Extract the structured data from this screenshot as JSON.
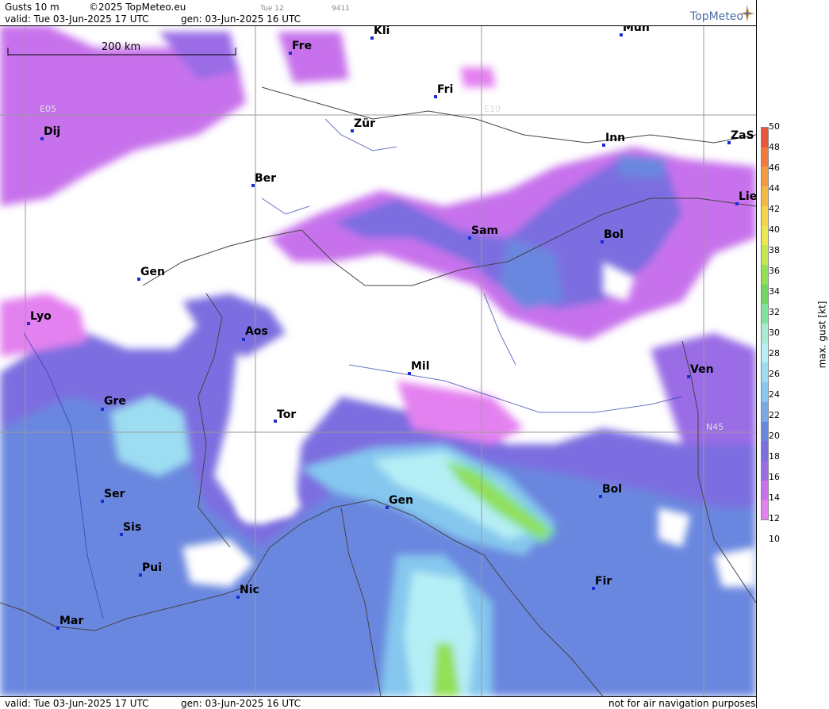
{
  "header": {
    "title": "Gusts 10 m",
    "copyright": "©2025 TopMeteo.eu",
    "valid": "valid:  Tue  03-Jun-2025  17 UTC",
    "gen": "gen:  03-Jun-2025  16 UTC",
    "small1": "Tue 12",
    "small2": "9411",
    "brand": "TopMeteo"
  },
  "footer": {
    "valid": "valid:  Tue  03-Jun-2025  17 UTC",
    "gen": "gen:  03-Jun-2025  16 UTC",
    "note": "not for air navigation purposes"
  },
  "scale": {
    "label": "200 km"
  },
  "grid": {
    "e05": "E05",
    "e10": "E10",
    "n45": "N45"
  },
  "legend": {
    "unit": "max. gust [kt]",
    "ticks": [
      "50",
      "48",
      "46",
      "44",
      "42",
      "40",
      "38",
      "36",
      "34",
      "32",
      "30",
      "28",
      "26",
      "24",
      "22",
      "20",
      "18",
      "16",
      "14",
      "12",
      "10"
    ],
    "colors": [
      "#e8573a",
      "#f07a3c",
      "#f49a40",
      "#f7b843",
      "#f5d44a",
      "#eaea50",
      "#c4e84e",
      "#93df55",
      "#6fd860",
      "#7fe39e",
      "#a8ecd6",
      "#b5eef5",
      "#9dddf2",
      "#85c7ee",
      "#78a9e6",
      "#6a87df",
      "#7b6ee0",
      "#9a6ce6",
      "#c772ec",
      "#e481f0"
    ]
  },
  "cities": [
    {
      "name": "Kli"
    },
    {
      "name": "Mün"
    },
    {
      "name": "Fre"
    },
    {
      "name": "Fri"
    },
    {
      "name": "Dij"
    },
    {
      "name": "Zür"
    },
    {
      "name": "Inn"
    },
    {
      "name": "ZaS"
    },
    {
      "name": "Ber"
    },
    {
      "name": "Lie"
    },
    {
      "name": "Sam"
    },
    {
      "name": "Bol"
    },
    {
      "name": "Gen"
    },
    {
      "name": "Lyo"
    },
    {
      "name": "Aos"
    },
    {
      "name": "Mil"
    },
    {
      "name": "Ven"
    },
    {
      "name": "Gre"
    },
    {
      "name": "Tor"
    },
    {
      "name": "Ser"
    },
    {
      "name": "Gen"
    },
    {
      "name": "Bol"
    },
    {
      "name": "Sis"
    },
    {
      "name": "Pui"
    },
    {
      "name": "Fir"
    },
    {
      "name": "Nic"
    },
    {
      "name": "Mar"
    }
  ]
}
